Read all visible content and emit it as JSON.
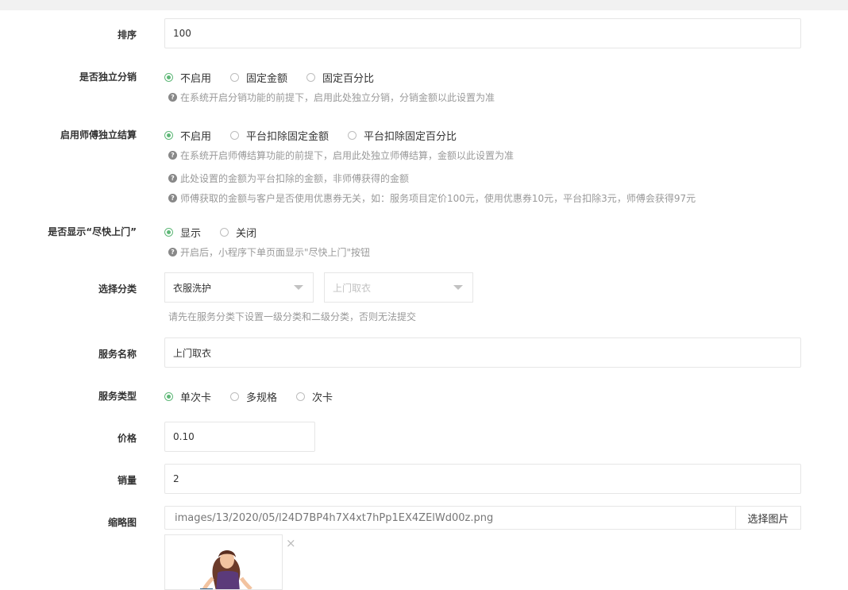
{
  "form": {
    "sort": {
      "label": "排序",
      "value": "100"
    },
    "independent_distribution": {
      "label": "是否独立分销",
      "options": [
        "不启用",
        "固定金额",
        "固定百分比"
      ],
      "selected": 0,
      "help": "在系统开启分销功能的前提下，启用此处独立分销，分销金额以此设置为准"
    },
    "master_settlement": {
      "label": "启用师傅独立结算",
      "options": [
        "不启用",
        "平台扣除固定金额",
        "平台扣除固定百分比"
      ],
      "selected": 0,
      "help1": "在系统开启师傅结算功能的前提下，启用此处独立师傅结算，金额以此设置为准",
      "help2": "此处设置的金额为平台扣除的金额，非师傅获得的金额",
      "help3": "师傅获取的金额与客户是否使用优惠券无关，如：服务项目定价100元，使用优惠券10元，平台扣除3元，师傅会获得97元"
    },
    "show_asap": {
      "label": "是否显示“尽快上门”",
      "options": [
        "显示",
        "关闭"
      ],
      "selected": 0,
      "help": "开启后，小程序下单页面显示\"尽快上门\"按钮"
    },
    "category": {
      "label": "选择分类",
      "first_value": "衣服洗护",
      "second_value": "上门取衣",
      "help": "请先在服务分类下设置一级分类和二级分类，否则无法提交"
    },
    "service_name": {
      "label": "服务名称",
      "value": "上门取衣"
    },
    "service_type": {
      "label": "服务类型",
      "options": [
        "单次卡",
        "多规格",
        "次卡"
      ],
      "selected": 0
    },
    "price": {
      "label": "价格",
      "value": "0.10"
    },
    "sales": {
      "label": "销量",
      "value": "2"
    },
    "thumbnail": {
      "label": "缩略图",
      "path": "images/13/2020/05/l24D7BP4h7X4xt7hPp1EX4ZElWd00z.png",
      "choose_label": "选择图片",
      "remove_glyph": "×"
    }
  },
  "icons": {
    "help": "question-circle-icon",
    "radio": "radio-icon",
    "caret": "caret-down-icon"
  },
  "colors": {
    "accent": "#5fb878",
    "border": "#e6e6e6",
    "muted": "#999999"
  }
}
